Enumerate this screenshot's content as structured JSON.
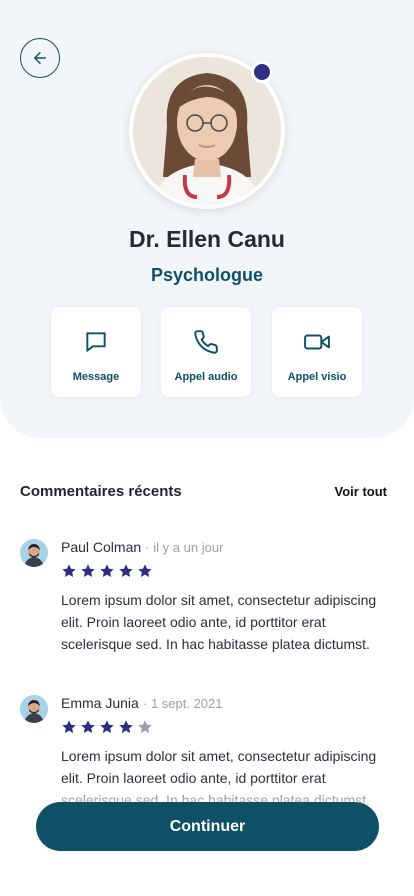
{
  "profile": {
    "name": "Dr. Ellen Canu",
    "role": "Psychologue",
    "status_color": "#2e2e82"
  },
  "actions": [
    {
      "label": "Message",
      "icon": "message-icon"
    },
    {
      "label": "Appel audio",
      "icon": "phone-icon"
    },
    {
      "label": "Appel visio",
      "icon": "video-icon"
    }
  ],
  "reviews_section": {
    "title": "Commentaires récents",
    "see_all": "Voir tout"
  },
  "reviews": [
    {
      "name": "Paul Colman",
      "separator": "·",
      "time": "il y a un jour",
      "rating": 5,
      "text": "Lorem ipsum dolor sit amet, consectetur adipiscing elit. Proin laoreet odio ante, id porttitor erat scelerisque sed. In hac habitasse platea dictumst."
    },
    {
      "name": "Emma Junia",
      "separator": "·",
      "time": "1 sept. 2021",
      "rating": 4,
      "text": "Lorem ipsum dolor sit amet, consectetur adipiscing elit. Proin laoreet odio ante, id porttitor erat scelerisque sed. In hac habitasse platea dictumst."
    }
  ],
  "cta": {
    "label": "Continuer"
  },
  "colors": {
    "primary": "#0e5166",
    "star": "#2e2e82",
    "star_empty": "#9aa0a6"
  }
}
